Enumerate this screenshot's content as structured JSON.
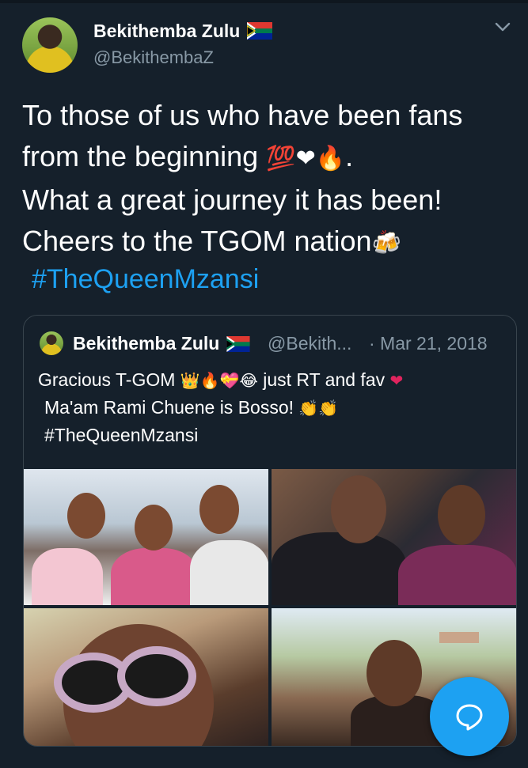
{
  "tweet": {
    "author_name": "Bekithemba Zulu",
    "author_handle": "@BekithembaZ",
    "text_lines": [
      "To those of us who have been fans",
      "from the beginning",
      "What a great journey it has been!",
      "Cheers to the TGOM nation"
    ],
    "line2_emojis": "💯❤🔥",
    "line2_tail": ".",
    "line4_emoji": "🍻",
    "hashtag": "#TheQueenMzansi"
  },
  "quoted_tweet": {
    "author_name": "Bekithemba Zulu",
    "author_handle": "@Bekith...",
    "date": "· Mar 21, 2018",
    "line1_a": "Gracious T-GOM",
    "line1_emojis": "👑🔥💝😂",
    "line1_b": "just RT and fav",
    "line1_emoji_end": "❤",
    "line2": "Ma'am Rami Chuene is Bosso!",
    "line2_emojis": "👏👏",
    "line3": "#TheQueenMzansi",
    "photos": [
      "photo-1",
      "photo-2",
      "photo-3",
      "photo-4"
    ]
  },
  "icons": {
    "flag": "south-africa-flag-icon",
    "menu": "chevron-down-icon",
    "compose": "chat-bubble-icon"
  },
  "colors": {
    "background": "#15202b",
    "accent": "#1da1f2",
    "secondary_text": "#8899a6",
    "border": "#38444d"
  }
}
